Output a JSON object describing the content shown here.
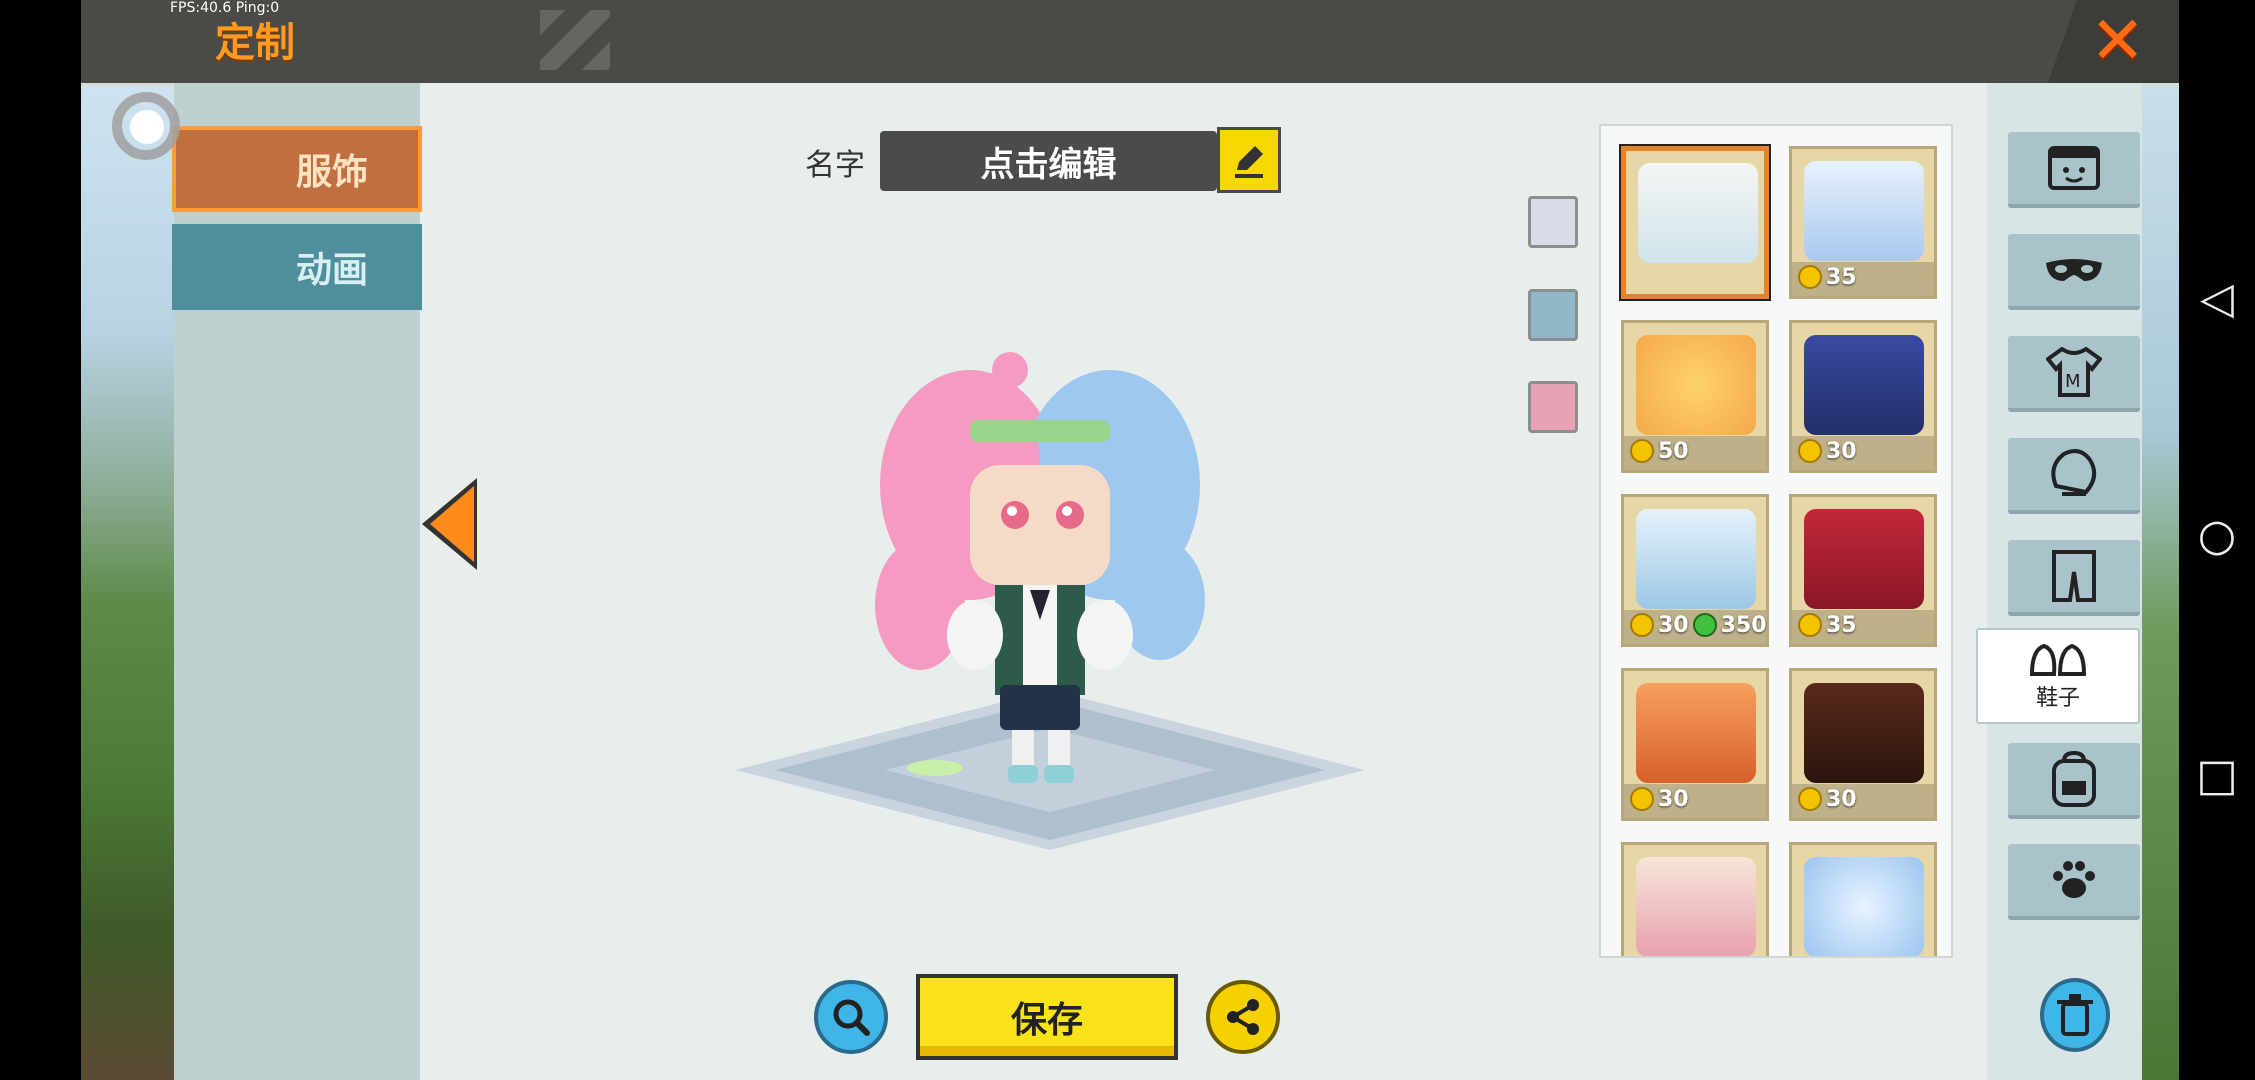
{
  "hud": {
    "fps": "FPS:40.6  Ping:0"
  },
  "header": {
    "title": "定制",
    "close_icon": "close-icon"
  },
  "left_tabs": [
    {
      "label": "服饰",
      "active": true
    },
    {
      "label": "动画",
      "active": false
    }
  ],
  "editor": {
    "name_label": "名字",
    "name_value": "点击编辑",
    "edit_icon": "pencil-icon"
  },
  "swatches": [
    "#d9dde8",
    "#8fb9c8",
    "#e8a2b6"
  ],
  "actions": {
    "save_label": "保存",
    "zoom_icon": "zoom-icon",
    "share_icon": "share-icon"
  },
  "items": [
    {
      "name": "white-sneakers",
      "selected": true,
      "prices": []
    },
    {
      "name": "winged-blue-shoes",
      "selected": false,
      "prices": [
        {
          "type": "coin",
          "amount": "35"
        }
      ]
    },
    {
      "name": "golden-flame-shoes",
      "selected": false,
      "prices": [
        {
          "type": "coin",
          "amount": "50"
        }
      ]
    },
    {
      "name": "navy-boots",
      "selected": false,
      "prices": [
        {
          "type": "coin",
          "amount": "30"
        }
      ]
    },
    {
      "name": "blue-rose-shoes",
      "selected": false,
      "prices": [
        {
          "type": "coin",
          "amount": "30"
        },
        {
          "type": "gem",
          "amount": "350"
        }
      ]
    },
    {
      "name": "christmas-boots",
      "selected": false,
      "prices": [
        {
          "type": "coin",
          "amount": "35"
        }
      ]
    },
    {
      "name": "orange-fur-boots",
      "selected": false,
      "prices": [
        {
          "type": "coin",
          "amount": "30"
        }
      ]
    },
    {
      "name": "dark-gold-boots",
      "selected": false,
      "prices": [
        {
          "type": "coin",
          "amount": "30"
        }
      ]
    },
    {
      "name": "pink-clover-shoes",
      "selected": false,
      "prices": []
    },
    {
      "name": "crystal-snowflake-shoes",
      "selected": false,
      "prices": []
    }
  ],
  "categories": [
    {
      "icon": "face-icon",
      "active": false
    },
    {
      "icon": "mask-icon",
      "active": false
    },
    {
      "icon": "shirt-icon",
      "active": false
    },
    {
      "icon": "gloves-icon",
      "active": false
    },
    {
      "icon": "pants-icon",
      "active": false
    },
    {
      "icon": "shoes-icon",
      "active": true,
      "label": "鞋子"
    },
    {
      "icon": "backpack-icon",
      "active": false
    },
    {
      "icon": "paw-icon",
      "active": false
    }
  ],
  "trash_icon": "trash-icon"
}
